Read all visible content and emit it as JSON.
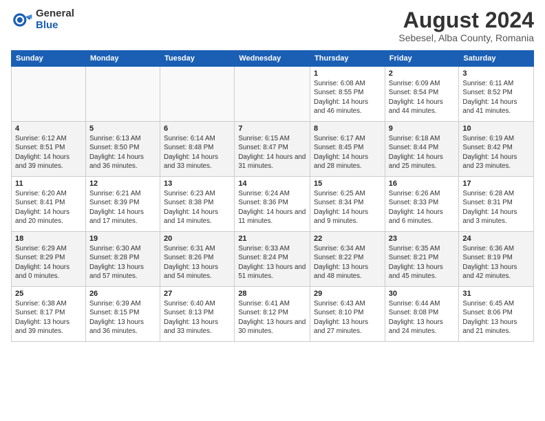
{
  "logo": {
    "general": "General",
    "blue": "Blue"
  },
  "header": {
    "title": "August 2024",
    "subtitle": "Sebesel, Alba County, Romania"
  },
  "days_of_week": [
    "Sunday",
    "Monday",
    "Tuesday",
    "Wednesday",
    "Thursday",
    "Friday",
    "Saturday"
  ],
  "weeks": [
    [
      {
        "day": null
      },
      {
        "day": null
      },
      {
        "day": null
      },
      {
        "day": null
      },
      {
        "day": 1,
        "sunrise": "6:08 AM",
        "sunset": "8:55 PM",
        "daylight": "14 hours and 46 minutes."
      },
      {
        "day": 2,
        "sunrise": "6:09 AM",
        "sunset": "8:54 PM",
        "daylight": "14 hours and 44 minutes."
      },
      {
        "day": 3,
        "sunrise": "6:11 AM",
        "sunset": "8:52 PM",
        "daylight": "14 hours and 41 minutes."
      }
    ],
    [
      {
        "day": 4,
        "sunrise": "6:12 AM",
        "sunset": "8:51 PM",
        "daylight": "14 hours and 39 minutes."
      },
      {
        "day": 5,
        "sunrise": "6:13 AM",
        "sunset": "8:50 PM",
        "daylight": "14 hours and 36 minutes."
      },
      {
        "day": 6,
        "sunrise": "6:14 AM",
        "sunset": "8:48 PM",
        "daylight": "14 hours and 33 minutes."
      },
      {
        "day": 7,
        "sunrise": "6:15 AM",
        "sunset": "8:47 PM",
        "daylight": "14 hours and 31 minutes."
      },
      {
        "day": 8,
        "sunrise": "6:17 AM",
        "sunset": "8:45 PM",
        "daylight": "14 hours and 28 minutes."
      },
      {
        "day": 9,
        "sunrise": "6:18 AM",
        "sunset": "8:44 PM",
        "daylight": "14 hours and 25 minutes."
      },
      {
        "day": 10,
        "sunrise": "6:19 AM",
        "sunset": "8:42 PM",
        "daylight": "14 hours and 23 minutes."
      }
    ],
    [
      {
        "day": 11,
        "sunrise": "6:20 AM",
        "sunset": "8:41 PM",
        "daylight": "14 hours and 20 minutes."
      },
      {
        "day": 12,
        "sunrise": "6:21 AM",
        "sunset": "8:39 PM",
        "daylight": "14 hours and 17 minutes."
      },
      {
        "day": 13,
        "sunrise": "6:23 AM",
        "sunset": "8:38 PM",
        "daylight": "14 hours and 14 minutes."
      },
      {
        "day": 14,
        "sunrise": "6:24 AM",
        "sunset": "8:36 PM",
        "daylight": "14 hours and 11 minutes."
      },
      {
        "day": 15,
        "sunrise": "6:25 AM",
        "sunset": "8:34 PM",
        "daylight": "14 hours and 9 minutes."
      },
      {
        "day": 16,
        "sunrise": "6:26 AM",
        "sunset": "8:33 PM",
        "daylight": "14 hours and 6 minutes."
      },
      {
        "day": 17,
        "sunrise": "6:28 AM",
        "sunset": "8:31 PM",
        "daylight": "14 hours and 3 minutes."
      }
    ],
    [
      {
        "day": 18,
        "sunrise": "6:29 AM",
        "sunset": "8:29 PM",
        "daylight": "14 hours and 0 minutes."
      },
      {
        "day": 19,
        "sunrise": "6:30 AM",
        "sunset": "8:28 PM",
        "daylight": "13 hours and 57 minutes."
      },
      {
        "day": 20,
        "sunrise": "6:31 AM",
        "sunset": "8:26 PM",
        "daylight": "13 hours and 54 minutes."
      },
      {
        "day": 21,
        "sunrise": "6:33 AM",
        "sunset": "8:24 PM",
        "daylight": "13 hours and 51 minutes."
      },
      {
        "day": 22,
        "sunrise": "6:34 AM",
        "sunset": "8:22 PM",
        "daylight": "13 hours and 48 minutes."
      },
      {
        "day": 23,
        "sunrise": "6:35 AM",
        "sunset": "8:21 PM",
        "daylight": "13 hours and 45 minutes."
      },
      {
        "day": 24,
        "sunrise": "6:36 AM",
        "sunset": "8:19 PM",
        "daylight": "13 hours and 42 minutes."
      }
    ],
    [
      {
        "day": 25,
        "sunrise": "6:38 AM",
        "sunset": "8:17 PM",
        "daylight": "13 hours and 39 minutes."
      },
      {
        "day": 26,
        "sunrise": "6:39 AM",
        "sunset": "8:15 PM",
        "daylight": "13 hours and 36 minutes."
      },
      {
        "day": 27,
        "sunrise": "6:40 AM",
        "sunset": "8:13 PM",
        "daylight": "13 hours and 33 minutes."
      },
      {
        "day": 28,
        "sunrise": "6:41 AM",
        "sunset": "8:12 PM",
        "daylight": "13 hours and 30 minutes."
      },
      {
        "day": 29,
        "sunrise": "6:43 AM",
        "sunset": "8:10 PM",
        "daylight": "13 hours and 27 minutes."
      },
      {
        "day": 30,
        "sunrise": "6:44 AM",
        "sunset": "8:08 PM",
        "daylight": "13 hours and 24 minutes."
      },
      {
        "day": 31,
        "sunrise": "6:45 AM",
        "sunset": "8:06 PM",
        "daylight": "13 hours and 21 minutes."
      }
    ]
  ]
}
